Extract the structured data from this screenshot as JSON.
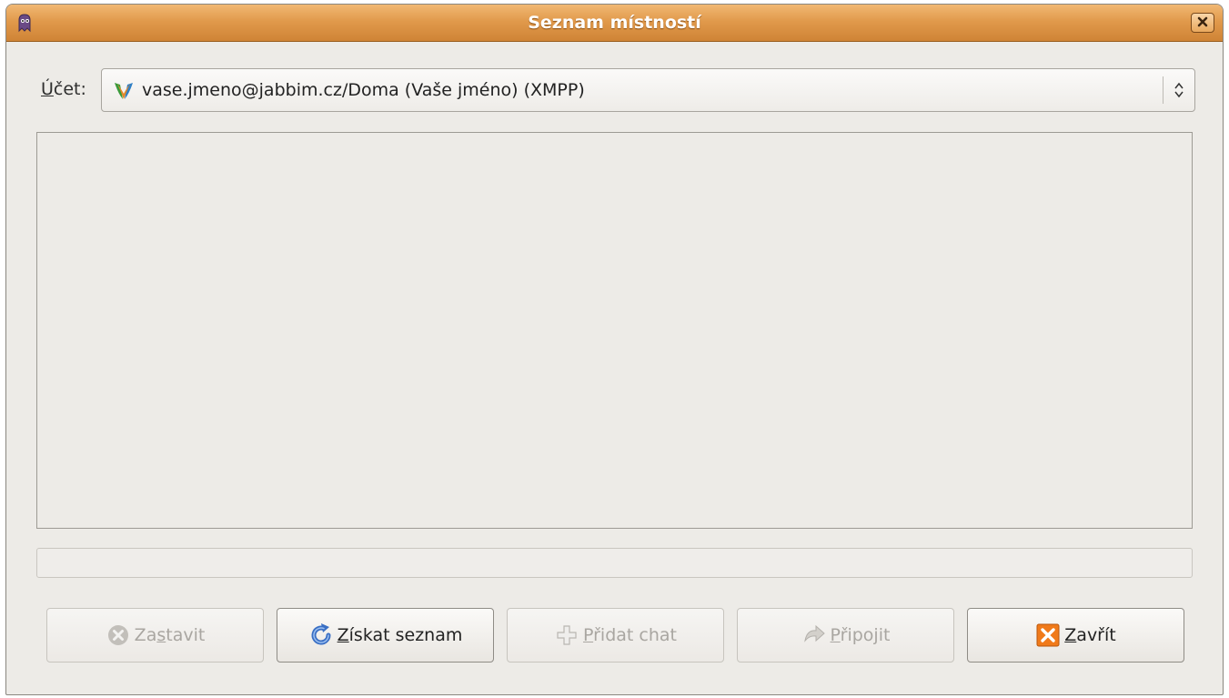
{
  "window": {
    "title": "Seznam místností",
    "app_icon": "pidgin-icon",
    "close_icon": "close-icon"
  },
  "account": {
    "label": "Účet:",
    "label_mnemonic": "Ú",
    "label_rest": "čet:",
    "selected": "vase.jmeno@jabbim.cz/Doma (Vaše jméno) (XMPP)",
    "protocol_icon": "xmpp-icon"
  },
  "room_list": {
    "items": []
  },
  "progress": {
    "value": 0
  },
  "buttons": [
    {
      "pre": "Za",
      "mnemonic": "s",
      "post": "tavit",
      "icon": "stop-icon",
      "enabled": false
    },
    {
      "pre": "",
      "mnemonic": "Z",
      "post": "ískat seznam",
      "icon": "refresh-icon",
      "enabled": true
    },
    {
      "pre": "",
      "mnemonic": "P",
      "post": "řidat chat",
      "icon": "add-icon",
      "enabled": false
    },
    {
      "pre": "",
      "mnemonic": "P",
      "post": "řipojit",
      "icon": "jump-icon",
      "enabled": false
    },
    {
      "pre": "",
      "mnemonic": "Z",
      "post": "avřít",
      "icon": "close-icon",
      "enabled": true
    }
  ],
  "colors": {
    "titlebar": "#e19a4c",
    "window_bg": "#edebe7",
    "close_accent": "#f07a1a",
    "refresh_accent": "#3a6fc4"
  }
}
